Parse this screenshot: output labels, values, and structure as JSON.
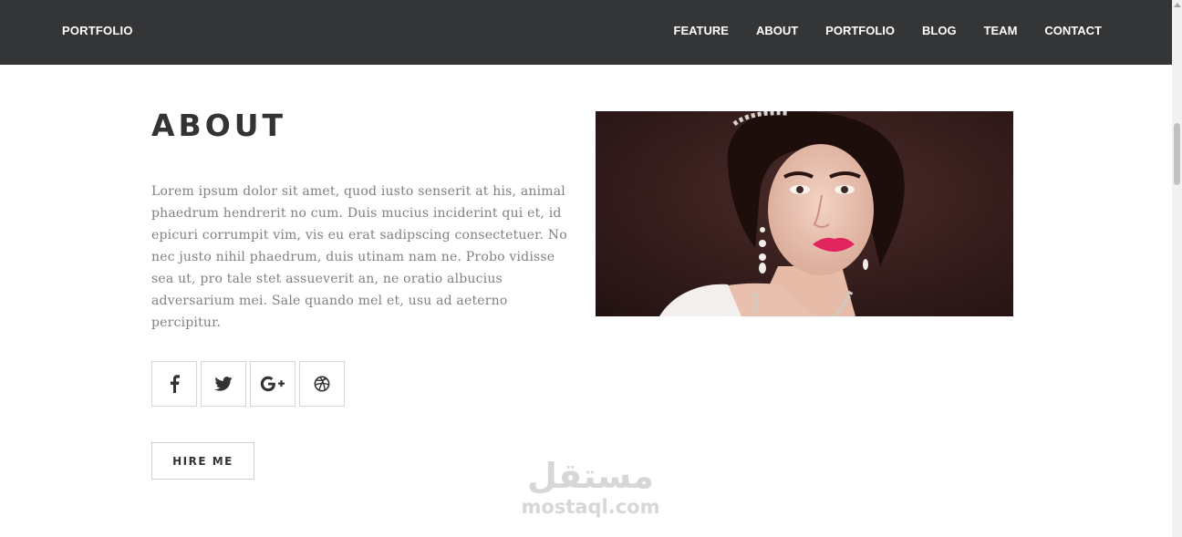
{
  "nav": {
    "brand": "PORTFOLIO",
    "links": [
      "FEATURE",
      "ABOUT",
      "PORTFOLIO",
      "BLOG",
      "TEAM",
      "CONTACT"
    ]
  },
  "about": {
    "title": "ABOUT",
    "text": "Lorem ipsum dolor sit amet, quod iusto senserit at his, animal phaedrum hendrerit no cum. Duis mucius inciderint qui et, id epicuri corrumpit vim, vis eu erat sadipscing consectetuer. No nec justo nihil phaedrum, duis utinam nam ne. Probo vidisse sea ut, pro tale stet assueverit an, ne oratio albucius adversarium mei. Sale quando mel et, usu ad aeterno percipitur.",
    "social_icons": [
      "facebook-icon",
      "twitter-icon",
      "google-plus-icon",
      "dribbble-icon"
    ],
    "hire_label": "HIRE ME"
  },
  "watermark": {
    "arabic": "مستقل",
    "latin": "mostaql.com"
  },
  "colors": {
    "navbar": "#333537",
    "title": "#333333",
    "body_text": "#808080",
    "lips": "#e0245e"
  }
}
